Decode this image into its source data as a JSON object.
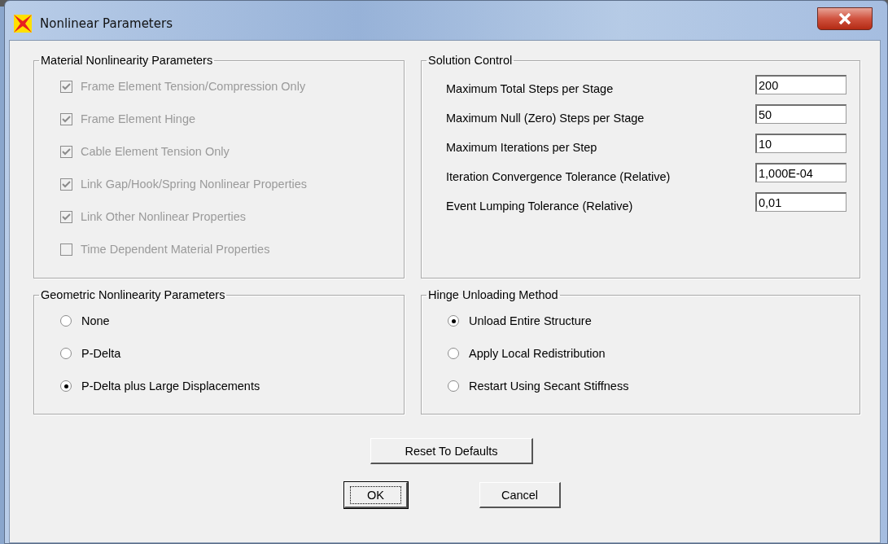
{
  "window": {
    "title": "Nonlinear Parameters"
  },
  "material": {
    "title": "Material Nonlinearity Parameters",
    "items": [
      {
        "label": "Frame Element Tension/Compression Only",
        "checked": true,
        "disabled": true
      },
      {
        "label": "Frame Element Hinge",
        "checked": true,
        "disabled": true
      },
      {
        "label": "Cable Element Tension Only",
        "checked": true,
        "disabled": true
      },
      {
        "label": "Link Gap/Hook/Spring Nonlinear Properties",
        "checked": true,
        "disabled": true
      },
      {
        "label": "Link Other Nonlinear Properties",
        "checked": true,
        "disabled": true
      },
      {
        "label": "Time Dependent Material Properties",
        "checked": false,
        "disabled": true
      }
    ]
  },
  "solution": {
    "title": "Solution Control",
    "fields": [
      {
        "label": "Maximum Total Steps per Stage",
        "value": "200"
      },
      {
        "label": "Maximum Null (Zero) Steps per Stage",
        "value": "50"
      },
      {
        "label": "Maximum Iterations per Step",
        "value": "10"
      },
      {
        "label": "Iteration Convergence Tolerance (Relative)",
        "value": "1,000E-04"
      },
      {
        "label": "Event Lumping Tolerance (Relative)",
        "value": "0,01"
      }
    ]
  },
  "geometric": {
    "title": "Geometric Nonlinearity Parameters",
    "options": [
      {
        "label": "None",
        "selected": false
      },
      {
        "label": "P-Delta",
        "selected": false
      },
      {
        "label": "P-Delta plus Large Displacements",
        "selected": true
      }
    ]
  },
  "hinge": {
    "title": "Hinge Unloading Method",
    "options": [
      {
        "label": "Unload Entire Structure",
        "selected": true
      },
      {
        "label": "Apply Local Redistribution",
        "selected": false
      },
      {
        "label": "Restart Using Secant Stiffness",
        "selected": false
      }
    ]
  },
  "reset_button": {
    "label": "Reset To Defaults"
  },
  "buttons": [
    {
      "label": "OK",
      "focused": true
    },
    {
      "label": "Cancel",
      "focused": false
    }
  ]
}
